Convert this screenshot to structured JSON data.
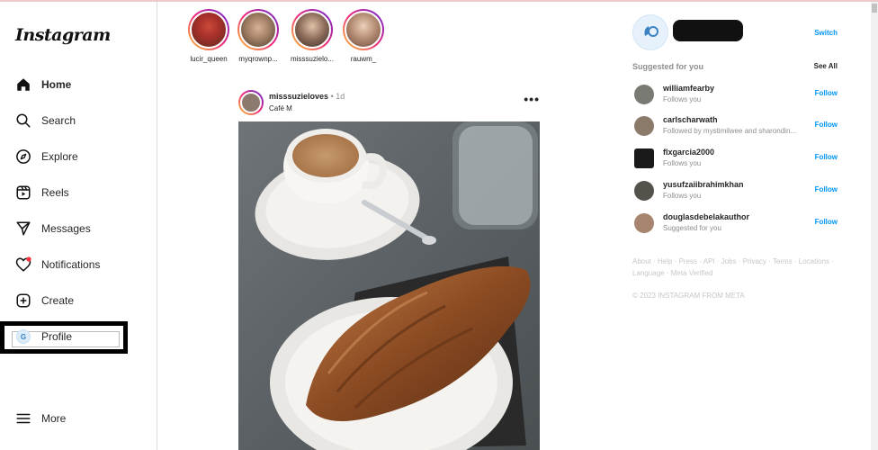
{
  "app": {
    "logo": "Instagram"
  },
  "sidebar": {
    "items": [
      {
        "label": "Home",
        "icon": "home-icon"
      },
      {
        "label": "Search",
        "icon": "search-icon"
      },
      {
        "label": "Explore",
        "icon": "compass-icon"
      },
      {
        "label": "Reels",
        "icon": "reels-icon"
      },
      {
        "label": "Messages",
        "icon": "send-icon"
      },
      {
        "label": "Notifications",
        "icon": "heart-icon"
      },
      {
        "label": "Create",
        "icon": "plus-square-icon"
      },
      {
        "label": "Profile",
        "icon": "profile-avatar"
      },
      {
        "label": "More",
        "icon": "menu-icon"
      }
    ]
  },
  "stories": [
    {
      "name": "lucir_queen"
    },
    {
      "name": "myqrownp..."
    },
    {
      "name": "misssuzielo..."
    },
    {
      "name": "rauwm_"
    }
  ],
  "post": {
    "username": "misssuzieloves",
    "time": "1d",
    "location": "Café M",
    "more_label": "•••"
  },
  "account": {
    "switch_label": "Switch"
  },
  "suggested": {
    "title": "Suggested for you",
    "see_all": "See All",
    "follow_label": "Follow",
    "items": [
      {
        "username": "williamfearby",
        "subtitle": "Follows you"
      },
      {
        "username": "carlscharwath",
        "subtitle": "Followed by mystimilwee and sharondin..."
      },
      {
        "username": "flxgarcia2000",
        "subtitle": "Follows you"
      },
      {
        "username": "yusufzaiibrahimkhan",
        "subtitle": "Follows you"
      },
      {
        "username": "douglasdebelakauthor",
        "subtitle": "Suggested for you"
      }
    ]
  },
  "footer": {
    "links": "About · Help · Press · API · Jobs · Privacy · Terms · Locations · Language · Meta Verified",
    "copyright": "© 2023 INSTAGRAM FROM META"
  },
  "colors": {
    "accent": "#0095f6",
    "muted": "#8e8e8e",
    "notification_dot": "#ff3040"
  }
}
